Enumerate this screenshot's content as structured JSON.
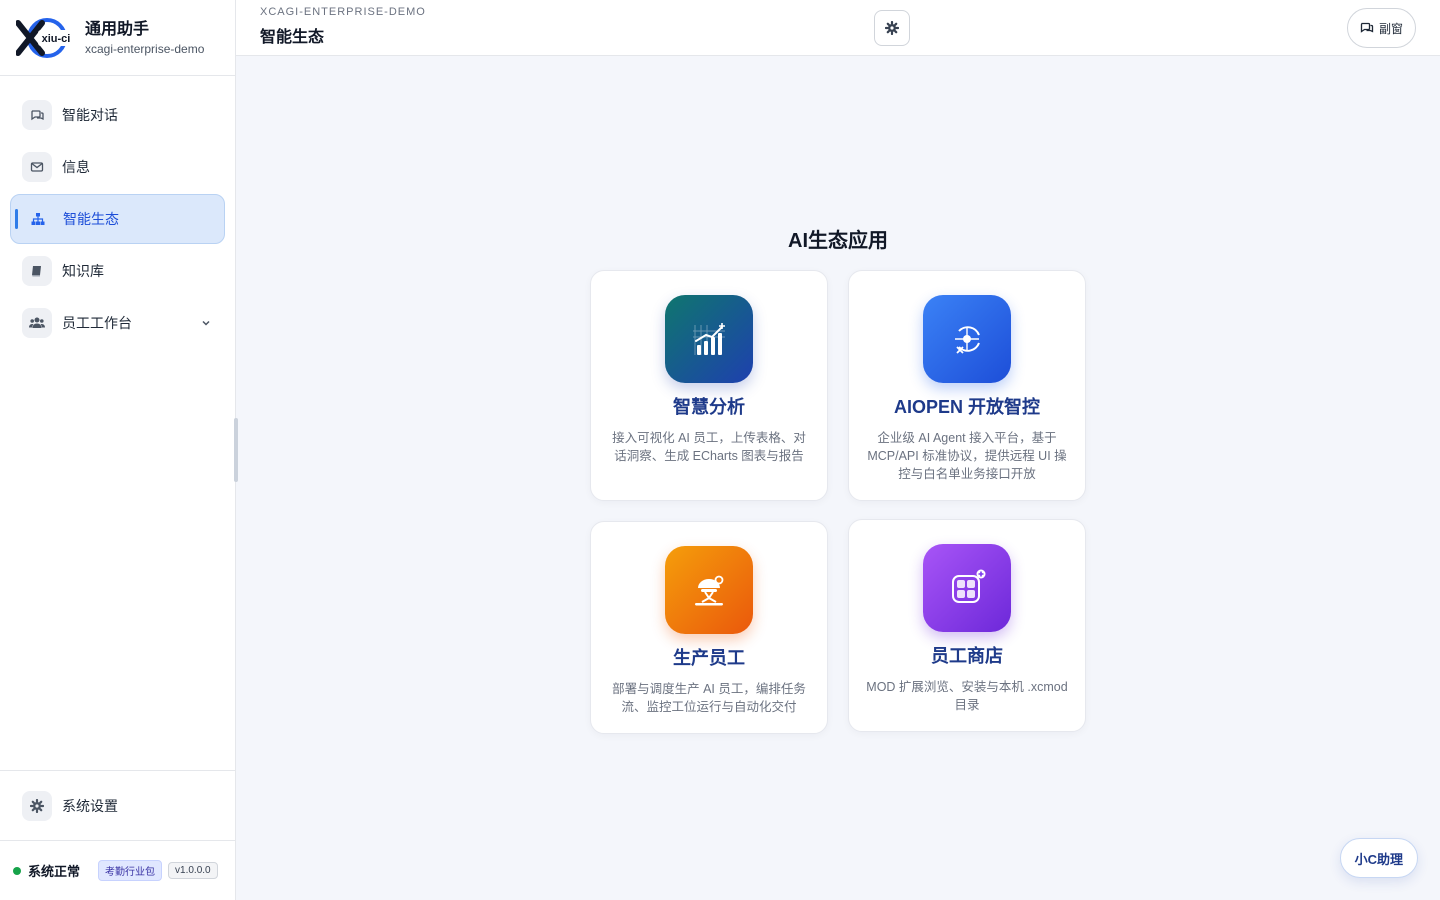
{
  "brand": {
    "logo_text": "xiu-ci",
    "title": "通用助手",
    "subtitle": "xcagi-enterprise-demo"
  },
  "sidebar": {
    "items": [
      {
        "label": "智能对话",
        "icon": "chat-icon",
        "active": false
      },
      {
        "label": "信息",
        "icon": "mail-icon",
        "active": false
      },
      {
        "label": "智能生态",
        "icon": "sitemap-icon",
        "active": true
      },
      {
        "label": "知识库",
        "icon": "book-icon",
        "active": false
      },
      {
        "label": "员工工作台",
        "icon": "users-icon",
        "active": false,
        "expandable": true
      }
    ],
    "settings_label": "系统设置",
    "status_text": "系统正常",
    "pack_badge": "考勤行业包",
    "version_badge": "v1.0.0.0"
  },
  "header": {
    "breadcrumb": "XCAGI-ENTERPRISE-DEMO",
    "title": "智能生态",
    "subwindow_label": "副窗"
  },
  "main": {
    "section_title": "AI生态应用",
    "cards": [
      {
        "name": "智慧分析",
        "desc": "接入可视化 AI 员工，上传表格、对话洞察、生成 ECharts 图表与报告",
        "icon": "chart-growth-icon"
      },
      {
        "name": "AIOPEN 开放智控",
        "desc": "企业级 AI Agent 接入平台，基于 MCP/API 标准协议，提供远程 UI 操控与白名单业务接口开放",
        "icon": "control-hub-icon"
      },
      {
        "name": "生产员工",
        "desc": "部署与调度生产 AI 员工，编排任务流、监控工位运行与自动化交付",
        "icon": "worker-robot-icon"
      },
      {
        "name": "员工商店",
        "desc": "MOD 扩展浏览、安装与本机 .xcmod 目录",
        "icon": "app-store-icon"
      }
    ]
  },
  "helper": {
    "label": "小C助理"
  },
  "colors": {
    "accent": "#2f7ce8",
    "active_bg": "#dbe8fb",
    "card_title": "#1e3a8a",
    "status_ok": "#16a34a"
  }
}
